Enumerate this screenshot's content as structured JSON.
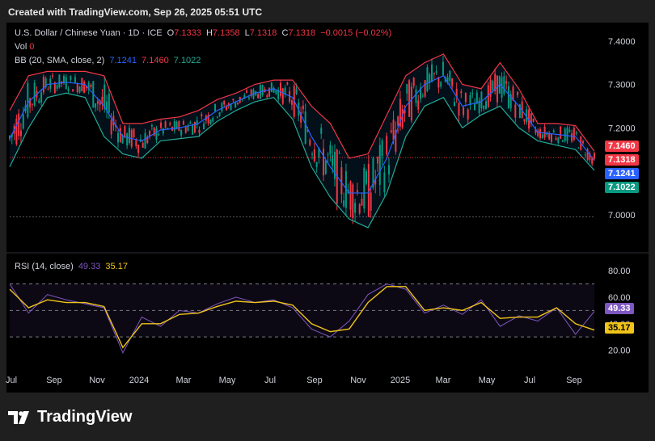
{
  "header": {
    "text": "Created with TradingView.com, Sep 26, 2025 05:51 UTC"
  },
  "brand": {
    "name": "TradingView"
  },
  "colors": {
    "up": "#089981",
    "down": "#f23645",
    "bb_upper": "#f23645",
    "bb_basis": "#2962ff",
    "bb_lower": "#22ab94",
    "rsi": "#7e57c2",
    "rsi_ma": "#f0c419",
    "bg": "#000000"
  },
  "legend": {
    "symbol": "U.S. Dollar / Chinese Yuan · 1D · ICE",
    "o_label": "O",
    "o_value": "7.1333",
    "h_label": "H",
    "h_value": "7.1358",
    "l_label": "L",
    "l_value": "7.1318",
    "c_label": "C",
    "c_value": "7.1318",
    "change": "−0.0015 (−0.02%)",
    "vol_label": "Vol",
    "vol_value": "0",
    "bb_label": "BB (20, SMA, close, 2)",
    "bb_basis": "7.1241",
    "bb_upper": "7.1460",
    "bb_lower": "7.1022",
    "rsi_label": "RSI (14, close)",
    "rsi_value": "49.33",
    "rsi_ma": "35.17"
  },
  "badges": {
    "bb_upper": "7.1460",
    "close": "7.1318",
    "bb_basis": "7.1241",
    "bb_lower": "7.1022",
    "rsi": "49.33",
    "rsi_ma": "35.17"
  },
  "chart_data": [
    {
      "type": "candlestick",
      "title": "U.S. Dollar / Chinese Yuan · 1D · ICE",
      "ylim": [
        6.955,
        7.42
      ],
      "y_ticks": [
        "7.4000",
        "7.3000",
        "7.2000",
        "7.1000",
        "7.0000"
      ],
      "x_ticks": [
        "Jul",
        "Sep",
        "Nov",
        "2024",
        "Mar",
        "May",
        "Jul",
        "Sep",
        "Nov",
        "2025",
        "Mar",
        "May",
        "Jul",
        "Sep"
      ],
      "series": [
        {
          "name": "BB (20, SMA, close, 2) basis",
          "values": [
            7.175,
            7.26,
            7.3,
            7.305,
            7.3,
            7.25,
            7.18,
            7.17,
            7.195,
            7.2,
            7.21,
            7.24,
            7.26,
            7.28,
            7.29,
            7.27,
            7.18,
            7.11,
            7.05,
            7.05,
            7.13,
            7.25,
            7.3,
            7.32,
            7.25,
            7.26,
            7.3,
            7.25,
            7.19,
            7.185,
            7.18,
            7.125
          ]
        },
        {
          "name": "BB (20, SMA, close, 2) upper",
          "values": [
            7.24,
            7.32,
            7.33,
            7.33,
            7.33,
            7.32,
            7.21,
            7.21,
            7.22,
            7.225,
            7.24,
            7.265,
            7.28,
            7.3,
            7.31,
            7.31,
            7.25,
            7.21,
            7.13,
            7.14,
            7.23,
            7.32,
            7.35,
            7.37,
            7.3,
            7.29,
            7.35,
            7.29,
            7.21,
            7.21,
            7.205,
            7.146
          ]
        },
        {
          "name": "BB (20, SMA, close, 2) lower",
          "values": [
            7.11,
            7.2,
            7.27,
            7.28,
            7.27,
            7.18,
            7.14,
            7.13,
            7.17,
            7.175,
            7.18,
            7.215,
            7.24,
            7.26,
            7.27,
            7.22,
            7.11,
            7.04,
            6.99,
            6.97,
            7.05,
            7.18,
            7.25,
            7.27,
            7.2,
            7.23,
            7.25,
            7.2,
            7.17,
            7.16,
            7.15,
            7.102
          ]
        }
      ],
      "last": {
        "open": 7.1333,
        "high": 7.1358,
        "low": 7.1318,
        "close": 7.1318
      },
      "volume": 0
    },
    {
      "type": "line",
      "title": "RSI (14, close)",
      "ylim": [
        10,
        88
      ],
      "y_ticks": [
        "80.00",
        "60.00",
        "40.00",
        "20.00"
      ],
      "bands": [
        70,
        50,
        30
      ],
      "series": [
        {
          "name": "RSI",
          "values": [
            70,
            48,
            62,
            58,
            55,
            52,
            18,
            45,
            38,
            50,
            48,
            55,
            60,
            56,
            58,
            52,
            36,
            30,
            42,
            62,
            70,
            66,
            48,
            54,
            47,
            58,
            38,
            46,
            42,
            52,
            32,
            49.33
          ]
        },
        {
          "name": "MA",
          "values": [
            66,
            52,
            58,
            56,
            56,
            53,
            22,
            40,
            40,
            47,
            48,
            53,
            57,
            56,
            57,
            54,
            40,
            34,
            36,
            56,
            68,
            68,
            50,
            52,
            50,
            56,
            44,
            45,
            45,
            52,
            40,
            35.17
          ]
        }
      ]
    }
  ]
}
